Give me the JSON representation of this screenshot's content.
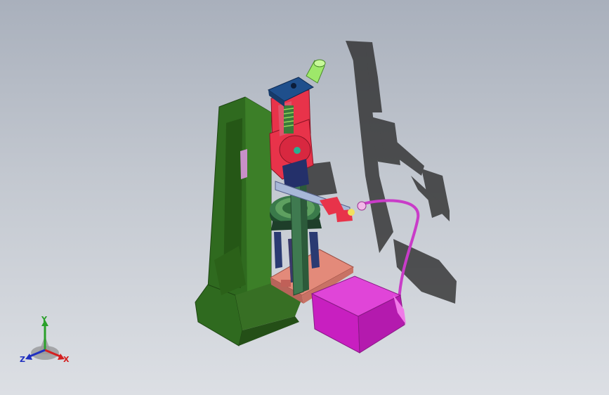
{
  "viewport": {
    "background_top": "#a9b0bc",
    "background_bottom": "#dcdfe4"
  },
  "model": {
    "frame_color": "#2f6a1f",
    "head_color": "#e8334a",
    "top_plate_color": "#1f4f8c",
    "knob_color": "#9ee86a",
    "base_plate_color": "#e38a7a",
    "column_color": "#3f7a50",
    "motor_box_color": "#d823c8",
    "cable_color": "#c93cc8",
    "shadow_color": "#2a2a2a"
  },
  "triad": {
    "y_label": "Y",
    "x_label": "X",
    "z_label": "Z",
    "y_color": "#2aa02a",
    "x_color": "#d42020",
    "z_color": "#2030c0"
  }
}
